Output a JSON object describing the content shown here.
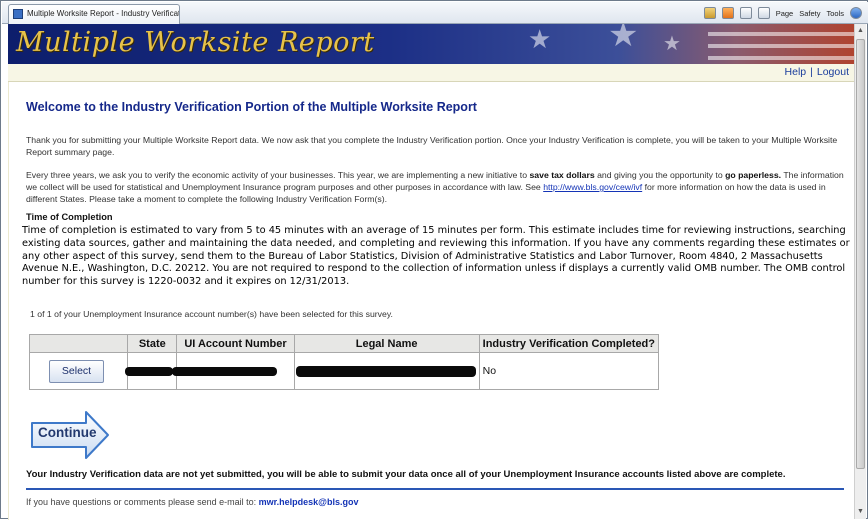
{
  "browser": {
    "tab_title": "Multiple Worksite Report - Industry Verification",
    "toolbar": {
      "page_label": "Page",
      "safety_label": "Safety",
      "tools_label": "Tools"
    }
  },
  "banner": {
    "title": "Multiple Worksite Report"
  },
  "topnav": {
    "help": "Help",
    "logout": "Logout"
  },
  "main": {
    "heading": "Welcome to the Industry Verification Portion of the Multiple Worksite Report",
    "intro": "Thank you for submitting your Multiple Worksite Report data. We now ask that you complete the Industry Verification portion. Once your Industry Verification is complete, you will be taken to your Multiple Worksite Report summary page.",
    "para2_a": "Every three years, we ask you to verify the economic activity of your businesses. This year, we are implementing a new initiative to ",
    "para2_bold1": "save tax dollars",
    "para2_b": " and giving you the opportunity to ",
    "para2_bold2": "go paperless.",
    "para2_c": " The information we collect will be used for statistical and Unemployment Insurance program purposes and other purposes in accordance with law. See ",
    "para2_link": "http://www.bls.gov/cew/ivf",
    "para2_d": " for more information on how the data is used in different States. Please take a moment to complete the following Industry Verification Form(s).",
    "time_heading": "Time of Completion",
    "time_text": "Time of completion is estimated to vary from 5 to 45 minutes with an average of 15 minutes per form.  This estimate includes time for reviewing instructions, searching existing data sources, gather and maintaining the data needed, and completing and reviewing this information.  If you have any comments regarding these estimates or any other aspect of this survey, send them to the Bureau of Labor Statistics, Division of Administrative Statistics and Labor Turnover, Room 4840, 2 Massachusetts Avenue N.E., Washington, D.C. 20212.  You are not required to respond to the collection of information unless if displays a currently valid OMB number.  The OMB control number for this survey is 1220-0032 and it expires on 12/31/2013.",
    "selected_note": "1 of 1 of your Unemployment Insurance account number(s) have been selected for this survey."
  },
  "table": {
    "headers": [
      "",
      "State",
      "UI Account Number",
      "Legal Name",
      "Industry Verification Completed?"
    ],
    "rows": [
      {
        "select_label": "Select",
        "completed": "No"
      }
    ]
  },
  "continue_label": "Continue",
  "notice": "Your Industry Verification data are not yet submitted, you will be able to submit your data once all of your Unemployment Insurance accounts listed above are complete.",
  "contact": {
    "text": "If you have questions or comments please send e-mail to:",
    "email": "mwr.helpdesk@bls.gov"
  },
  "colors": {
    "banner_bg": "#0d1e6c",
    "banner_title": "#e7c34a",
    "heading": "#15288a",
    "link": "#1434b6"
  }
}
